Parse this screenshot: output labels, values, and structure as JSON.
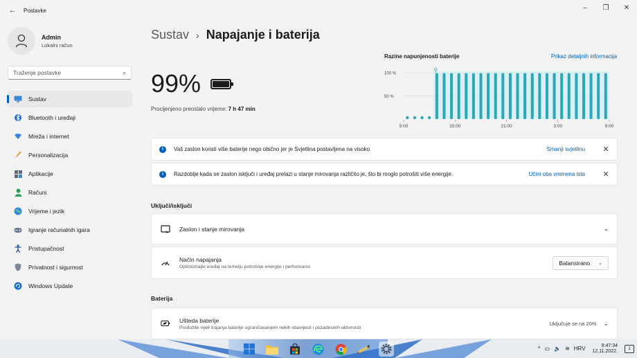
{
  "window": {
    "title": "Postavke",
    "controls": {
      "minimize": "–",
      "restore": "❐",
      "close": "✕"
    }
  },
  "profile": {
    "name": "Admin",
    "subtitle": "Lokalni račun"
  },
  "search": {
    "placeholder": "Traženje postavke"
  },
  "nav": [
    {
      "label": "Sustav",
      "icon": "monitor-icon",
      "active": true
    },
    {
      "label": "Bluetooth i uređaji",
      "icon": "bluetooth-icon"
    },
    {
      "label": "Mreža i internet",
      "icon": "wifi-icon"
    },
    {
      "label": "Personalizacija",
      "icon": "brush-icon"
    },
    {
      "label": "Aplikacije",
      "icon": "apps-icon"
    },
    {
      "label": "Računi",
      "icon": "person-icon"
    },
    {
      "label": "Vrijeme i jezik",
      "icon": "globe-icon"
    },
    {
      "label": "Igranje računalnih igara",
      "icon": "gamepad-icon"
    },
    {
      "label": "Pristupačnost",
      "icon": "accessibility-icon"
    },
    {
      "label": "Privatnost i sigurnost",
      "icon": "shield-icon"
    },
    {
      "label": "Windows Update",
      "icon": "update-icon"
    }
  ],
  "breadcrumb": {
    "parent": "Sustav",
    "separator": "›",
    "current": "Napajanje i baterija"
  },
  "battery": {
    "percent": "99%",
    "estimate_label": "Procijenjeno preostalo vrijeme:",
    "estimate_value": "7 h 47 min"
  },
  "chart_data": {
    "type": "bar",
    "title": "Razine napunjenosti baterije",
    "link": "Prikaz detaljnih informacija",
    "yticks": [
      "100 %",
      "50 %"
    ],
    "xticks": [
      "9:00",
      "15:00",
      "21:00",
      "3:00",
      "9:00"
    ],
    "ylim": [
      0,
      100
    ],
    "dots_before_bars": 4,
    "values": [
      99,
      99,
      99,
      99,
      99,
      99,
      99,
      99,
      99,
      99,
      99,
      99,
      99,
      99,
      99,
      99,
      99,
      99,
      99,
      99,
      99,
      99,
      99,
      99
    ],
    "colors": {
      "bar": "#2aa7b8",
      "band": "#c4ecf0",
      "dot": "#2aa7b8",
      "grid": "#e0e0e0"
    },
    "charging_icon": "plug-icon"
  },
  "infobars": [
    {
      "text": "Vaš zaslon koristi više baterije nego obično jer je Svjetlina postavljena na visoko",
      "link": "Smanji svjetlinu",
      "close": "✕"
    },
    {
      "text": "Razdoblje kada se zaslon isključi i uređaj prelazi u stanje mirovanja različito je, što bi moglo potrošiti više energije.",
      "link": "Učini oba vremena ista",
      "close": "✕"
    }
  ],
  "sections": {
    "power": "Uključi/isključi",
    "battery": "Baterija"
  },
  "cards": {
    "screen_sleep": {
      "title": "Zaslon i stanje mirovanja"
    },
    "power_mode": {
      "title": "Način napajanja",
      "subtitle": "Optimizirajte uređaj na temelju potrošnje energije i performansi",
      "value": "Balansirano"
    },
    "battery_saver": {
      "title": "Ušteda baterije",
      "subtitle": "Produžite vijek trajanja baterije ograničavanjem nekih obavijesti i pozadinskih aktivnosti",
      "status": "Uključuje se na 20%"
    }
  },
  "taskbar": {
    "apps": [
      "windows-start-icon",
      "file-explorer-icon",
      "store-icon",
      "edge-icon",
      "chrome-icon",
      "paint-icon",
      "settings-icon"
    ],
    "tray": {
      "chevron": "^",
      "language": "HRV",
      "time": "9:47:34",
      "date": "12.11.2022.",
      "notif_count": "1"
    }
  }
}
